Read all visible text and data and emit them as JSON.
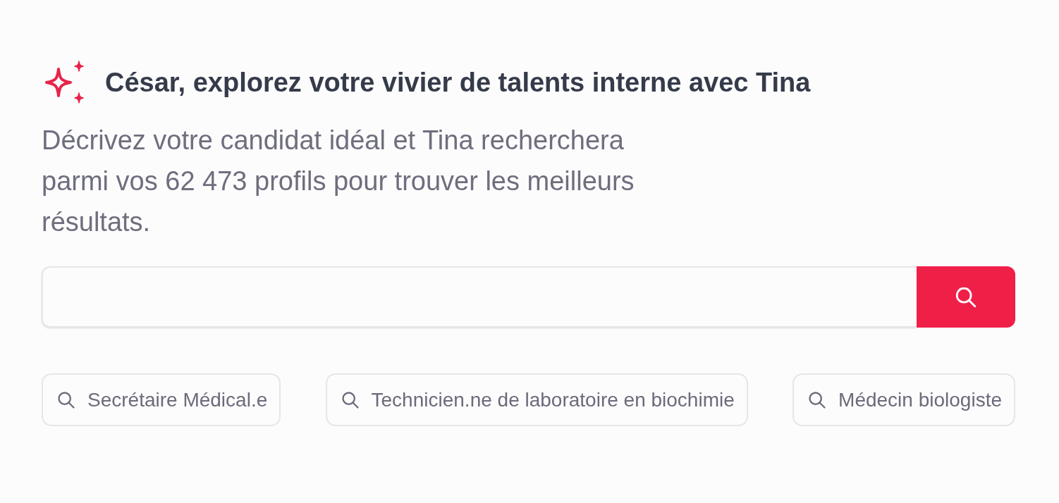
{
  "heading": {
    "title": "César, explorez votre vivier de talents interne avec Tina"
  },
  "description": "Décrivez votre candidat idéal et Tina recherchera parmi vos 62 473 profils pour trouver les meilleurs résultats.",
  "suggestions": [
    {
      "label": "Secrétaire Médical.e"
    },
    {
      "label": "Technicien.ne de laboratoire en biochimie"
    },
    {
      "label": "Médecin biologiste"
    }
  ]
}
